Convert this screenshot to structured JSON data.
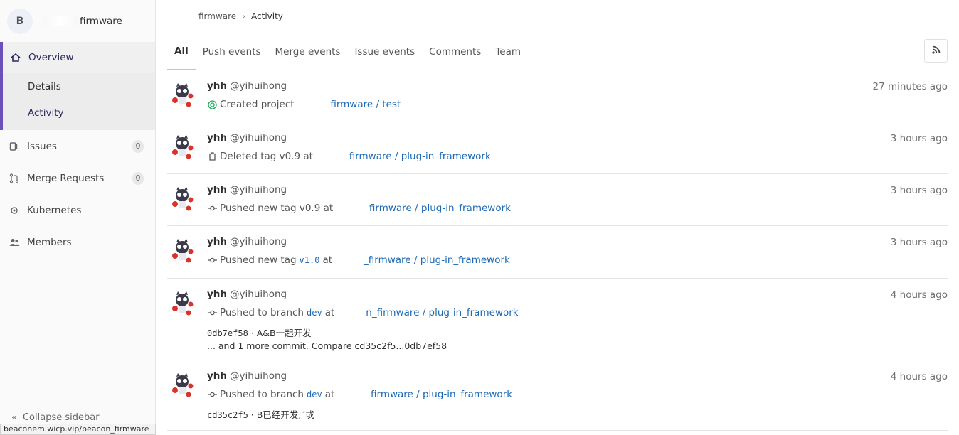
{
  "group": {
    "initial": "B",
    "name": "firmware"
  },
  "sidebar": {
    "overview": "Overview",
    "details": "Details",
    "activity": "Activity",
    "issues": {
      "label": "Issues",
      "count": "0"
    },
    "merge_requests": {
      "label": "Merge Requests",
      "count": "0"
    },
    "kubernetes": "Kubernetes",
    "members": "Members",
    "collapse": "Collapse sidebar"
  },
  "status_url": "beaconem.wicp.vip/beacon_firmware",
  "breadcrumb": {
    "parent": "firmware",
    "current": "Activity"
  },
  "tabs": [
    "All",
    "Push events",
    "Merge events",
    "Issue events",
    "Comments",
    "Team"
  ],
  "rss_icon": "rss-icon",
  "events": [
    {
      "user": "yhh",
      "handle": "@yihuihong",
      "time": "27 minutes ago",
      "action": "Created project",
      "target": "_firmware / test"
    },
    {
      "user": "yhh",
      "handle": "@yihuihong",
      "time": "3 hours ago",
      "action": "Deleted tag v0.9 at",
      "target": "_firmware / plug-in_framework"
    },
    {
      "user": "yhh",
      "handle": "@yihuihong",
      "time": "3 hours ago",
      "action": "Pushed new tag v0.9 at",
      "target": "_firmware / plug-in_framework"
    },
    {
      "user": "yhh",
      "handle": "@yihuihong",
      "time": "3 hours ago",
      "action": "Pushed new tag",
      "ref": "v1.0",
      "action2": "at",
      "target": "_firmware / plug-in_framework"
    },
    {
      "user": "yhh",
      "handle": "@yihuihong",
      "time": "4 hours ago",
      "action": "Pushed to branch",
      "ref": "dev",
      "action2": "at",
      "target": "n_firmware / plug-in_framework",
      "commit_sha": "0db7ef58",
      "commit_msg": "· A&B一起开发",
      "more": "... and 1 more commit. Compare cd35c2f5...0db7ef58"
    },
    {
      "user": "yhh",
      "handle": "@yihuihong",
      "time": "4 hours ago",
      "action": "Pushed to branch",
      "ref": "dev",
      "action2": "at",
      "target": "_firmware / plug-in_framework",
      "commit_sha": "cd35c2f5",
      "commit_msg": "· B已经开发‚ˊ戓"
    }
  ]
}
